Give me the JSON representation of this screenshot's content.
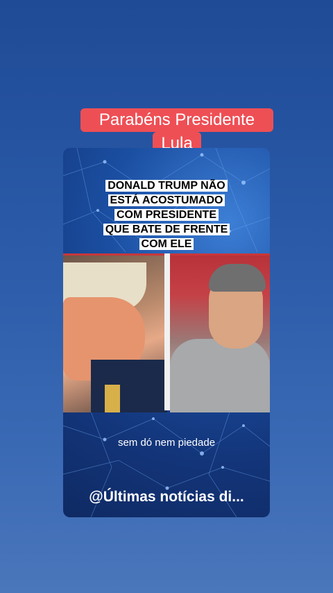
{
  "overlay_title": {
    "line1": "Parabéns Presidente",
    "line2": "Lula"
  },
  "video": {
    "headline": [
      "DONALD TRUMP NÃO",
      "ESTÁ ACOSTUMADO",
      "COM PRESIDENTE",
      "QUE BATE DE FRENTE",
      "COM ELE"
    ],
    "caption": "sem dó nem piedade",
    "channel_handle": "@Últimas notícias di..."
  },
  "colors": {
    "title_bg": "#ee4f55",
    "background": "#2a5aa8"
  }
}
